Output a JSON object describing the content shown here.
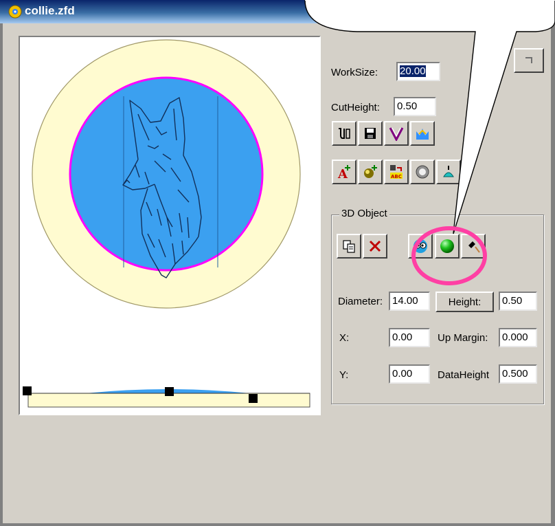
{
  "window": {
    "title": "collie.zfd"
  },
  "params": {
    "worksize_label": "WorkSize:",
    "worksize_value": "20.00",
    "cutheight_label": "CutHeight:",
    "cutheight_value": "0.50"
  },
  "group": {
    "title": "3D Object",
    "diameter_label": "Diameter:",
    "diameter_value": "14.00",
    "height_button": "Height:",
    "height_value": "0.50",
    "x_label": "X:",
    "x_value": "0.00",
    "upmargin_label": "Up Margin:",
    "upmargin_value": "0.000",
    "y_label": "Y:",
    "y_value": "0.00",
    "dataheight_label": "DataHeight",
    "dataheight_value": "0.500"
  },
  "colors": {
    "relief_blue": "#3ba0f0",
    "outer_disc": "#fffbd0",
    "ring_magenta": "#ff00ff",
    "highlight_circle": "#ff3fa4",
    "green_sphere": "#1fc21f"
  },
  "icons": {
    "toolbar_row1": [
      "tool-select-icon",
      "save-icon",
      "v-carve-icon",
      "relief-icon"
    ],
    "toolbar_row2": [
      "add-text-icon",
      "add-object-icon",
      "text-abc-icon",
      "circle-icon",
      "shape-icon"
    ],
    "group_row": [
      "copy-icon",
      "delete-icon",
      "eyes-icon",
      "green-sphere-icon",
      "brush-icon"
    ]
  }
}
